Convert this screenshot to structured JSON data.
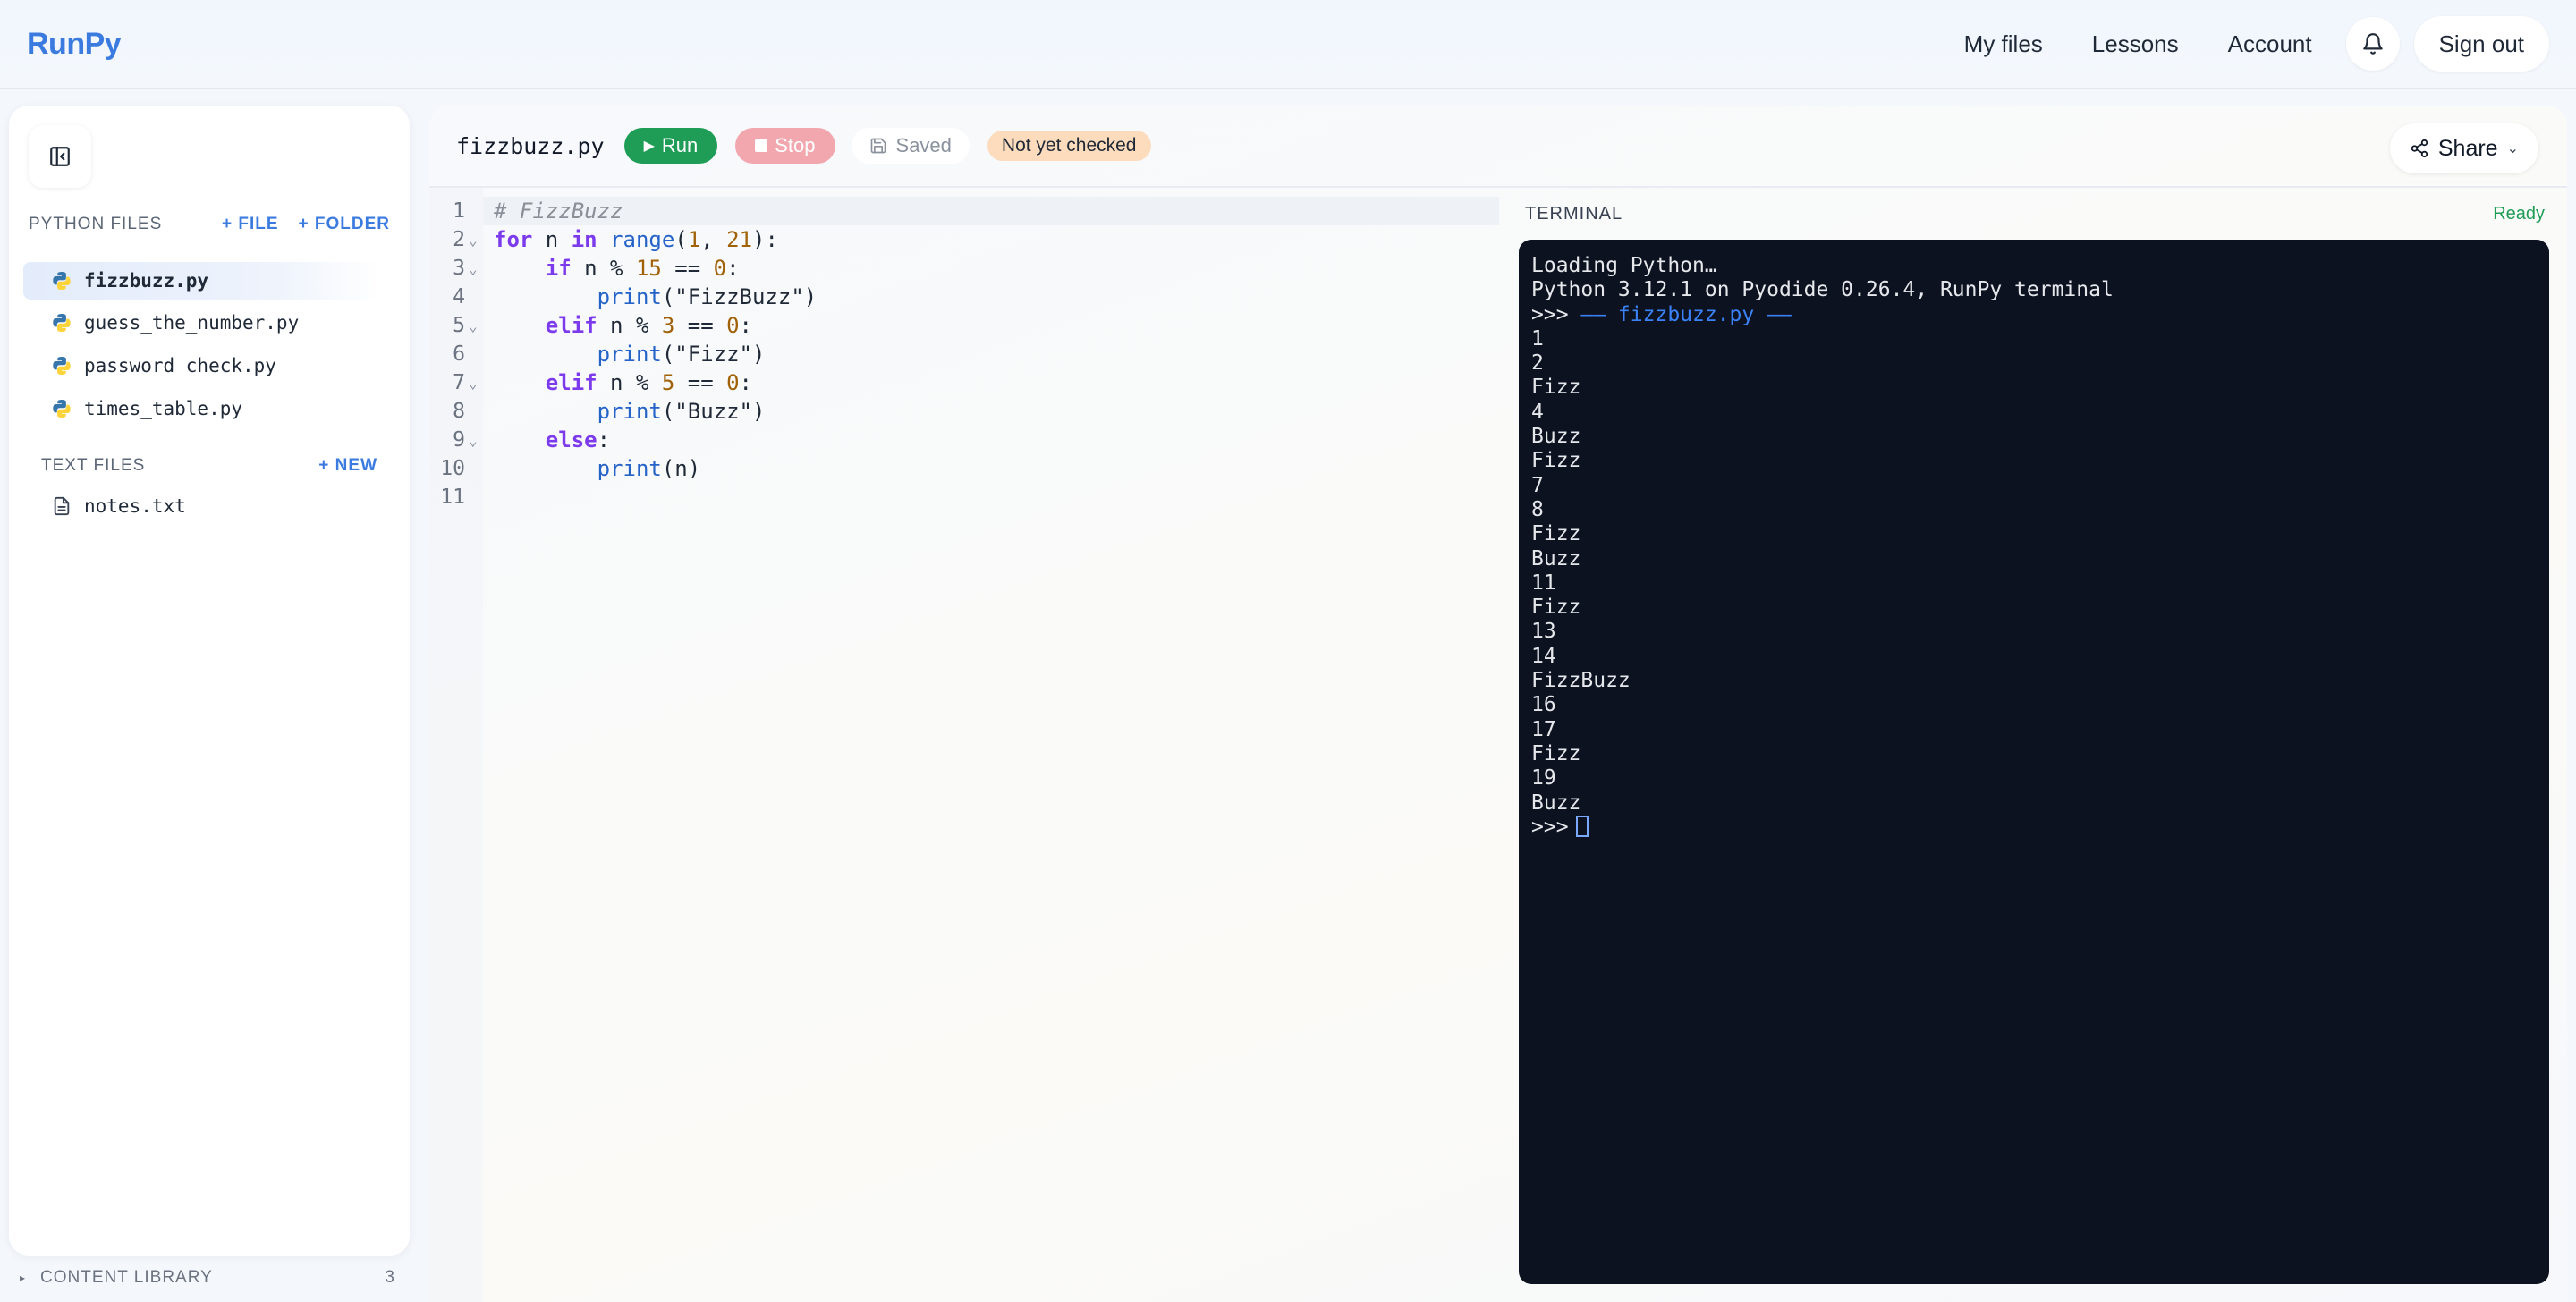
{
  "app": {
    "logo": "RunPy"
  },
  "nav": {
    "links": [
      "My files",
      "Lessons",
      "Account"
    ],
    "sign_out": "Sign out"
  },
  "sidebar": {
    "python_section": {
      "title": "PYTHON FILES",
      "add_file": "+ FILE",
      "add_folder": "+ FOLDER"
    },
    "python_files": [
      "fizzbuzz.py",
      "guess_the_number.py",
      "password_check.py",
      "times_table.py"
    ],
    "text_section": {
      "title": "TEXT FILES",
      "add_new": "+ NEW"
    },
    "text_files": [
      "notes.txt"
    ],
    "content_library": {
      "label": "CONTENT LIBRARY",
      "count": "3"
    }
  },
  "toolbar": {
    "filename": "fizzbuzz.py",
    "run": "Run",
    "stop": "Stop",
    "saved": "Saved",
    "check_status": "Not yet checked",
    "share": "Share"
  },
  "editor": {
    "line_numbers": [
      "1",
      "2",
      "3",
      "4",
      "5",
      "6",
      "7",
      "8",
      "9",
      "10",
      "11"
    ],
    "lines": [
      "# FizzBuzz",
      "for n in range(1, 21):",
      "    if n % 15 == 0:",
      "        print(\"FizzBuzz\")",
      "    elif n % 3 == 0:",
      "        print(\"Fizz\")",
      "    elif n % 5 == 0:",
      "        print(\"Buzz\")",
      "    else:",
      "        print(n)",
      ""
    ]
  },
  "terminal": {
    "title": "TERMINAL",
    "status": "Ready",
    "header_lines": [
      "Loading Python…",
      "Python 3.12.1 on Pyodide 0.26.4, RunPy terminal"
    ],
    "run_marker_prompt": ">>> ",
    "run_marker": "—— fizzbuzz.py ——",
    "output": [
      "1",
      "2",
      "Fizz",
      "4",
      "Buzz",
      "Fizz",
      "7",
      "8",
      "Fizz",
      "Buzz",
      "11",
      "Fizz",
      "13",
      "14",
      "FizzBuzz",
      "16",
      "17",
      "Fizz",
      "19",
      "Buzz"
    ],
    "prompt": ">>>"
  },
  "colors": {
    "accent": "#3b7be0",
    "run_green": "#1f9d57",
    "stop_pink": "#f2a7ae",
    "badge_orange": "#fcdcbc",
    "terminal_bg": "#0c1220"
  },
  "icons": {
    "bell": "bell-icon",
    "collapse": "sidebar-collapse-icon",
    "python_file": "python-file-icon",
    "text_file": "text-file-icon",
    "share": "share-icon",
    "save": "save-icon"
  }
}
